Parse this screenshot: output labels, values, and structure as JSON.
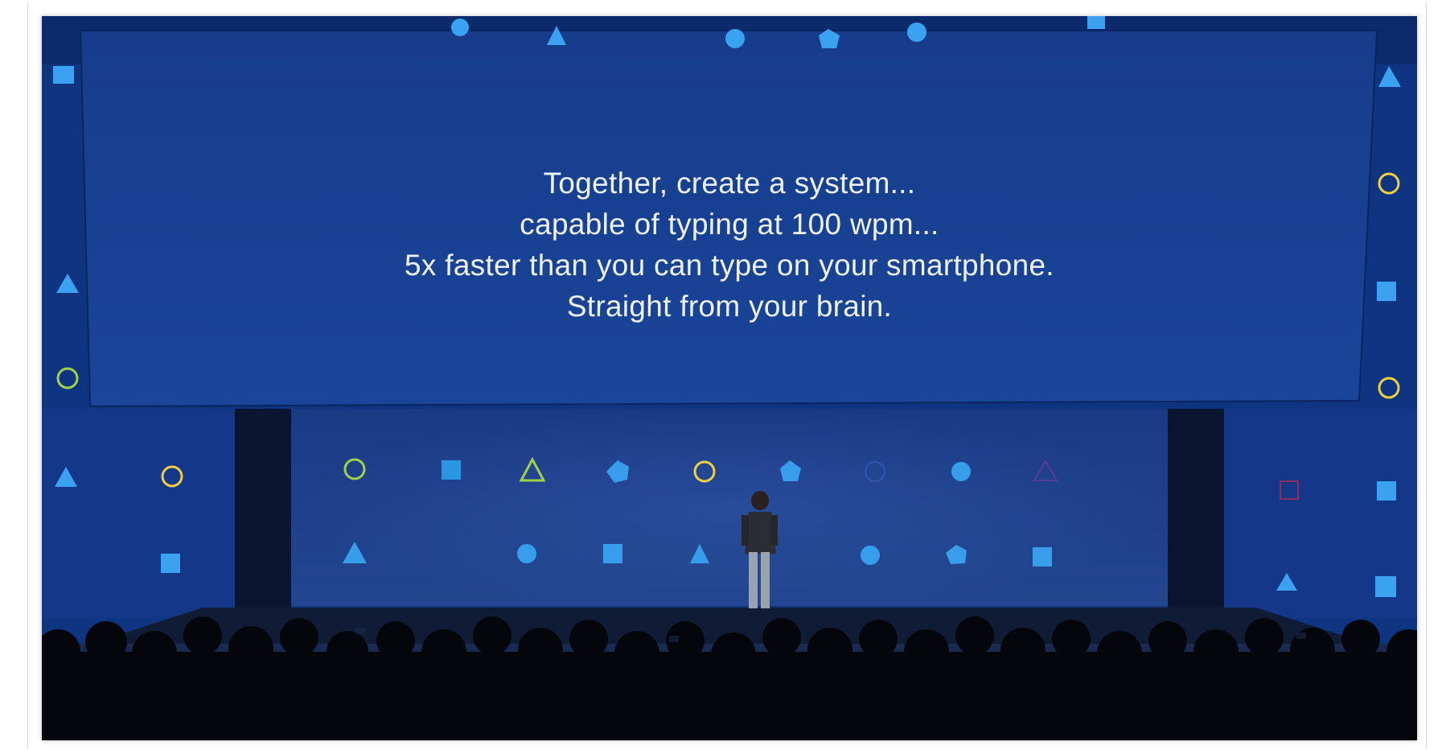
{
  "slide": {
    "lines": [
      "Together, create a system...",
      "capable of typing at 100 wpm...",
      "5x faster than you can type on your smartphone.",
      "Straight from your brain."
    ]
  },
  "scene": {
    "screen_color": "#173e90",
    "stage_backdrop_color": "#1c3a88",
    "icons": [
      "cube-icon",
      "pyramid-icon",
      "dodecahedron-icon",
      "sphere-icon"
    ]
  }
}
